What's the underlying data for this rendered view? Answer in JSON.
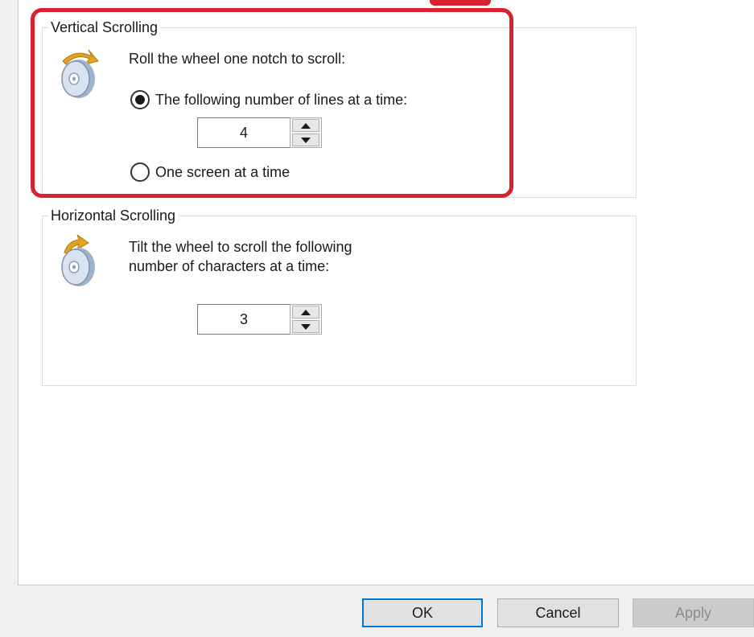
{
  "vertical_scrolling": {
    "title": "Vertical Scrolling",
    "instruction": "Roll the wheel one notch to scroll:",
    "option_lines_label": "The following number of lines at a time:",
    "option_lines_selected": true,
    "lines_value": "4",
    "option_screen_label": "One screen at a time",
    "option_screen_selected": false,
    "icon": "mouse-wheel-icon"
  },
  "horizontal_scrolling": {
    "title": "Horizontal Scrolling",
    "instruction_line1": "Tilt the wheel to scroll the following",
    "instruction_line2": "number of characters at a time:",
    "chars_value": "3",
    "icon": "mouse-wheel-tilt-icon"
  },
  "footer": {
    "ok_label": "OK",
    "cancel_label": "Cancel",
    "apply_label": "Apply"
  },
  "colors": {
    "highlight": "#d9222f",
    "default_button_border": "#0078d7"
  }
}
